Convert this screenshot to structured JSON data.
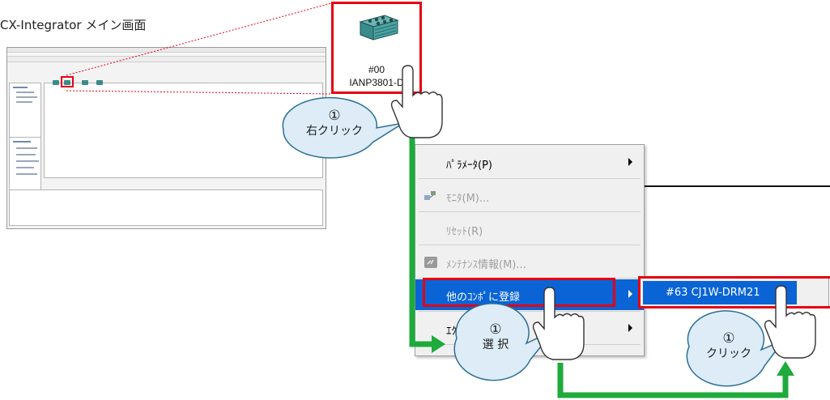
{
  "caption": "CX-Integrator メイン画面",
  "device": {
    "address": "#00",
    "model": "IANP3801-D"
  },
  "context_menu": {
    "items": [
      {
        "label": "ﾊﾟﾗﾒｰﾀ(P)",
        "enabled": true,
        "has_submenu": true,
        "icon": ""
      },
      {
        "label": "ﾓﾆﾀ(M)...",
        "enabled": false,
        "has_submenu": false,
        "icon": "monitor-icon"
      },
      {
        "label": "ﾘｾｯﾄ(R)",
        "enabled": false,
        "has_submenu": false,
        "icon": ""
      },
      {
        "label": "ﾒﾝﾃﾅﾝｽ情報(M)...",
        "enabled": false,
        "has_submenu": false,
        "icon": "maintenance-icon"
      },
      {
        "label": "他のｺﾝﾎﾟに登録",
        "enabled": true,
        "has_submenu": true,
        "highlighted": true,
        "icon": ""
      },
      {
        "label": "ｴｸｽﾎﾟｰﾄ",
        "enabled": true,
        "has_submenu": true,
        "icon": ""
      }
    ]
  },
  "submenu": {
    "item_label": "#63 CJ1W-DRM21"
  },
  "callouts": [
    {
      "number": "①",
      "text": "右クリック"
    },
    {
      "number": "①",
      "text": "選 択"
    },
    {
      "number": "①",
      "text": "クリック"
    }
  ],
  "colors": {
    "highlight_red": "#e60012",
    "arrow_green": "#1faa3c",
    "menu_selection_blue": "#0a64d6",
    "bubble_fill": "#ddecf7",
    "bubble_stroke": "#2a6f97"
  }
}
